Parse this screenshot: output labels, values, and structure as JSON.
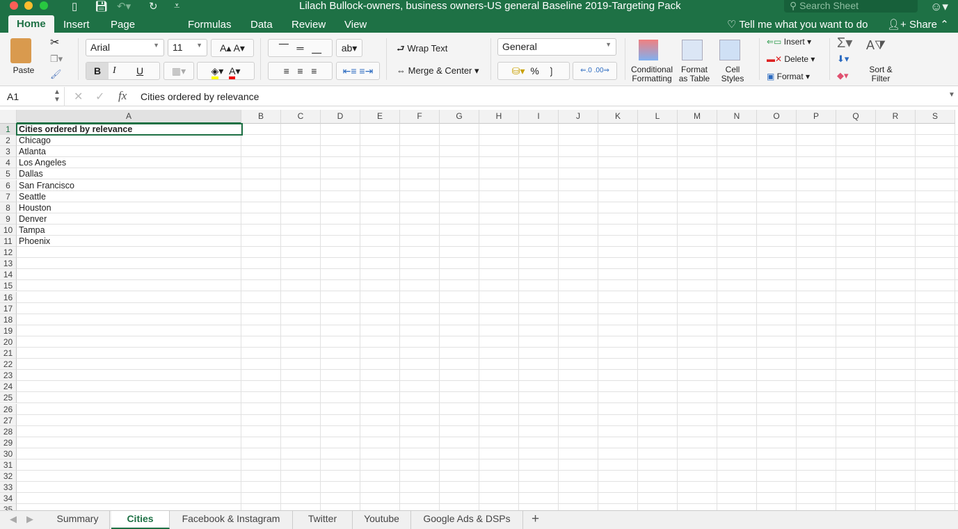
{
  "window": {
    "title": "Lilach Bullock-owners, business owners-US general Baseline 2019-Targeting Pack",
    "search_placeholder": "Search Sheet"
  },
  "menu_tabs": [
    "Home",
    "Insert",
    "Page Layout",
    "Formulas",
    "Data",
    "Review",
    "View"
  ],
  "tell_me": "Tell me what you want to do",
  "share": "Share",
  "ribbon": {
    "paste": "Paste",
    "font": "Arial",
    "size": "11",
    "wrap_text": "Wrap Text",
    "merge_center": "Merge & Center",
    "number_format": "General",
    "conditional_formatting": [
      "Conditional",
      "Formatting"
    ],
    "format_as_table": [
      "Format",
      "as Table"
    ],
    "cell_styles": [
      "Cell",
      "Styles"
    ],
    "insert": "Insert",
    "delete": "Delete",
    "format": "Format",
    "sort_filter": [
      "Sort &",
      "Filter"
    ],
    "bold": "B",
    "italic": "I",
    "underline": "U",
    "percent": "%",
    "comma": "❳"
  },
  "formula_bar": {
    "name_box": "A1",
    "fx": "fx",
    "value": "Cities ordered by relevance"
  },
  "columns": [
    "A",
    "B",
    "C",
    "D",
    "E",
    "F",
    "G",
    "H",
    "I",
    "J",
    "K",
    "L",
    "M",
    "N",
    "O",
    "P",
    "Q",
    "R",
    "S"
  ],
  "cells": [
    "Cities ordered by relevance",
    "Chicago",
    "Atlanta",
    "Los Angeles",
    "Dallas",
    "San Francisco",
    "Seattle",
    "Houston",
    "Denver",
    "Tampa",
    "Phoenix"
  ],
  "row_count": 34,
  "sheets": [
    "Summary",
    "Cities",
    "Facebook & Instagram",
    "Twitter",
    "Youtube",
    "Google Ads & DSPs"
  ],
  "active_sheet": "Cities",
  "colors": {
    "brand": "#1e7145"
  }
}
